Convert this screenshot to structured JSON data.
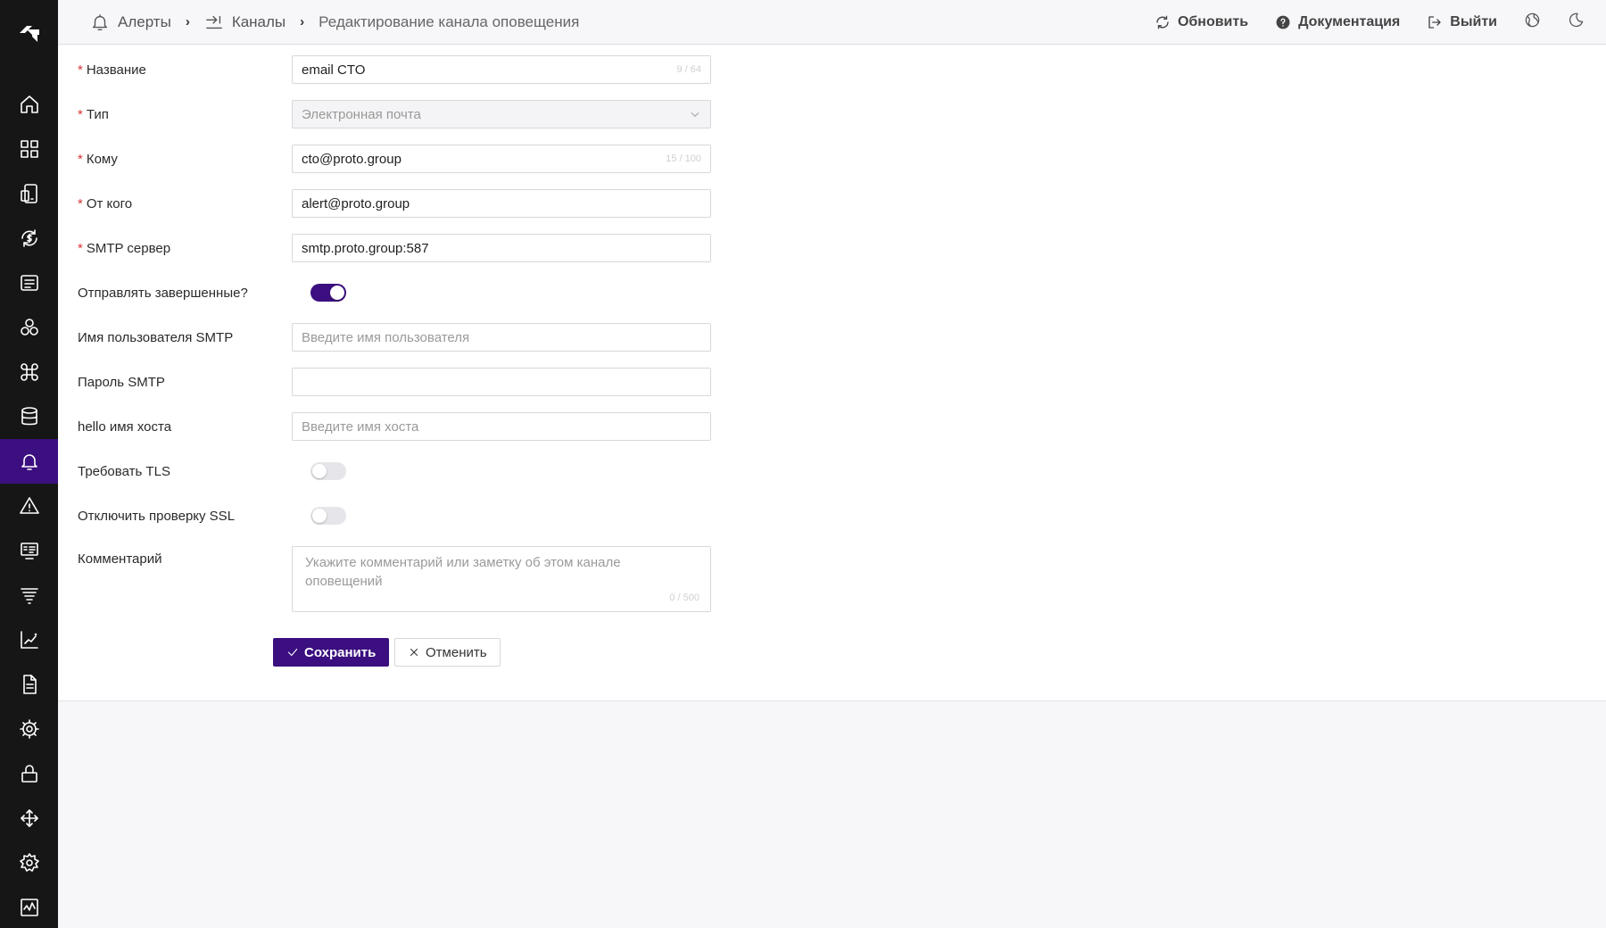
{
  "breadcrumb": {
    "items": [
      {
        "label": "Алерты",
        "icon": "bell-icon"
      },
      {
        "label": "Каналы",
        "icon": "channel-arrow-icon"
      },
      {
        "label": "Редактирование канала оповещения"
      }
    ]
  },
  "header": {
    "refresh_label": "Обновить",
    "docs_label": "Документация",
    "logout_label": "Выйти"
  },
  "sidebar": {
    "items": [
      {
        "icon": "home-icon"
      },
      {
        "icon": "dashboard-grid-icon"
      },
      {
        "icon": "devices-icon"
      },
      {
        "icon": "sync-dollar-icon"
      },
      {
        "icon": "list-icon"
      },
      {
        "icon": "circles-icon"
      },
      {
        "icon": "command-icon"
      },
      {
        "icon": "database-icon"
      },
      {
        "icon": "bell-icon",
        "active": true
      },
      {
        "icon": "warning-icon"
      },
      {
        "icon": "monitor-list-icon"
      },
      {
        "icon": "filter-icon"
      },
      {
        "icon": "chart-icon"
      },
      {
        "icon": "document-icon"
      },
      {
        "icon": "gear-network-icon"
      },
      {
        "icon": "lock-icon"
      },
      {
        "icon": "move-icon"
      },
      {
        "icon": "settings-icon"
      },
      {
        "icon": "activity-icon"
      }
    ]
  },
  "form": {
    "name": {
      "label": "Название",
      "value": "email CTO",
      "counter": "9 / 64"
    },
    "type": {
      "label": "Тип",
      "value": "Электронная почта"
    },
    "to": {
      "label": "Кому",
      "value": "cto@proto.group",
      "counter": "15 / 100"
    },
    "from": {
      "label": "От кого",
      "value": "alert@proto.group"
    },
    "smtp_server": {
      "label": "SMTP сервер",
      "value": "smtp.proto.group:587"
    },
    "send_resolved": {
      "label": "Отправлять завершенные?",
      "on": true
    },
    "smtp_user": {
      "label": "Имя пользователя SMTP",
      "value": "",
      "placeholder": "Введите имя пользователя"
    },
    "smtp_password": {
      "label": "Пароль SMTP",
      "value": ""
    },
    "hello_host": {
      "label": "hello имя хоста",
      "value": "",
      "placeholder": "Введите имя хоста"
    },
    "require_tls": {
      "label": "Требовать TLS",
      "on": false
    },
    "skip_ssl": {
      "label": "Отключить проверку SSL",
      "on": false
    },
    "comment": {
      "label": "Комментарий",
      "placeholder": "Укажите комментарий или заметку об этом канале оповещений",
      "counter": "0 / 500"
    }
  },
  "buttons": {
    "save_label": "Сохранить",
    "cancel_label": "Отменить"
  },
  "colors": {
    "accent": "#3b0f7f",
    "sidebar": "#161616",
    "required": "#d93535"
  }
}
